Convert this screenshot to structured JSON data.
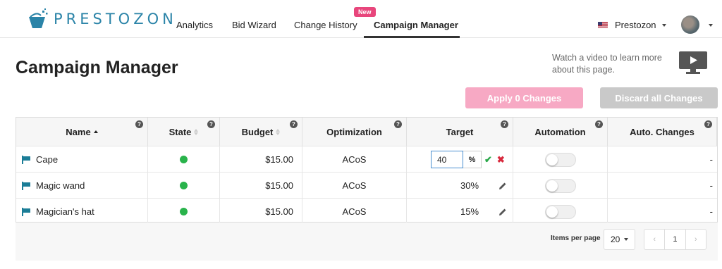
{
  "brand": {
    "name": "PRESTOZON"
  },
  "nav": {
    "links": [
      "Analytics",
      "Bid Wizard",
      "Change History",
      "Campaign Manager"
    ],
    "badge": "New",
    "account": "Prestozon"
  },
  "page": {
    "title": "Campaign Manager",
    "video_text": "Watch a video to learn more about this page."
  },
  "actions": {
    "apply": "Apply 0 Changes",
    "discard": "Discard all Changes"
  },
  "table": {
    "columns": [
      "Name",
      "State",
      "Budget",
      "Optimization",
      "Target",
      "Automation",
      "Auto. Changes"
    ],
    "help_glyph": "?",
    "rows": [
      {
        "name": "Cape",
        "state": "enabled",
        "budget": "$15.00",
        "optimization": "ACoS",
        "target": "40",
        "target_unit": "%",
        "automation": false,
        "auto_changes": "-"
      },
      {
        "name": "Magic wand",
        "state": "enabled",
        "budget": "$15.00",
        "optimization": "ACoS",
        "target": "30%",
        "automation": false,
        "auto_changes": "-"
      },
      {
        "name": "Magician's hat",
        "state": "enabled",
        "budget": "$15.00",
        "optimization": "ACoS",
        "target": "15%",
        "automation": false,
        "auto_changes": "-"
      }
    ]
  },
  "pagination": {
    "items_per_page_label": "Items per page",
    "items_per_page": "20",
    "current_page": "1",
    "prev": "‹",
    "next": "›"
  },
  "colors": {
    "brand": "#2b84a8",
    "badge": "#e8467c",
    "apply": "#f7a9c4",
    "discard": "#c9c9c9",
    "state_on": "#29b34b",
    "flag": "#1b7d97",
    "confirm": "#2aa84a",
    "cancel": "#d8283c"
  },
  "icons": {
    "state": "status-dot",
    "name": "flag-icon",
    "edit": "pencil-icon",
    "video": "video-play-icon"
  }
}
